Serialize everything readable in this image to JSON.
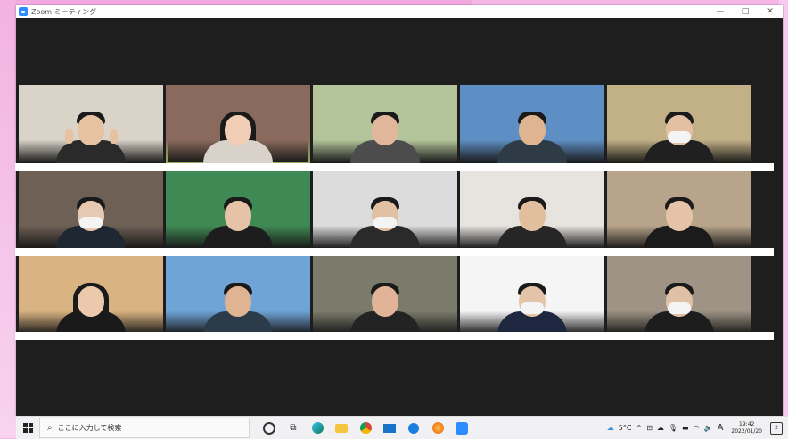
{
  "window": {
    "title": "Zoom ミーティング",
    "minimize": "—",
    "maximize": "□",
    "close": "✕"
  },
  "participants": [
    {
      "id": "p1",
      "bg": "#d9d3c8",
      "body": "#2a2a2a",
      "skin": "#e7c2a0",
      "mask": false,
      "gesture": "peace"
    },
    {
      "id": "p2",
      "bg": "#8a6a5c",
      "body": "#d9d2cb",
      "skin": "#f0cdb4",
      "mask": false,
      "active": true,
      "long_hair": true
    },
    {
      "id": "p3",
      "bg": "#b3c49a",
      "body": "#4c4c4c",
      "skin": "#e1b79b",
      "mask": false
    },
    {
      "id": "p4",
      "bg": "#5e8fc4",
      "body": "#2e3a46",
      "skin": "#dfb491",
      "mask": false
    },
    {
      "id": "p5",
      "bg": "#c2b186",
      "body": "#202020",
      "skin": "#e4c0a2",
      "mask": true
    },
    {
      "id": "p6",
      "bg": "#6e6055",
      "body": "#1f2733",
      "skin": "#e7c8b0",
      "mask": true
    },
    {
      "id": "p7",
      "bg": "#3f8a54",
      "body": "#1d1d1d",
      "skin": "#e6c3a6",
      "mask": false
    },
    {
      "id": "p8",
      "bg": "#dcdcdc",
      "body": "#2a2a2a",
      "skin": "#e2c0a4",
      "mask": true
    },
    {
      "id": "p9",
      "bg": "#e7e3df",
      "body": "#262626",
      "skin": "#e1be9e",
      "mask": false
    },
    {
      "id": "p10",
      "bg": "#b8a48a",
      "body": "#1b1b1b",
      "skin": "#e5c3a6",
      "mask": false
    },
    {
      "id": "p11",
      "bg": "#d9b381",
      "body": "#1a1a1a",
      "skin": "#eac9ad",
      "mask": false,
      "long_hair": true
    },
    {
      "id": "p12",
      "bg": "#6ea4d6",
      "body": "#2c3b49",
      "skin": "#e0b393",
      "mask": false
    },
    {
      "id": "p13",
      "bg": "#7b7b6b",
      "body": "#232323",
      "skin": "#e2b497",
      "mask": false
    },
    {
      "id": "p14",
      "bg": "#f5f5f5",
      "body": "#1d2740",
      "skin": "#e4c4a8",
      "mask": true
    },
    {
      "id": "p15",
      "bg": "#9e9384",
      "body": "#1d1d1d",
      "skin": "#e1c1a5",
      "mask": true
    }
  ],
  "taskbar": {
    "search_placeholder": "ここに入力して検索",
    "pinned_icons": [
      "cortana-icon",
      "task-view-icon",
      "edge-icon",
      "file-explorer-icon",
      "chrome-icon",
      "mail-icon",
      "app-icon",
      "firefox-icon",
      "zoom-icon"
    ],
    "weather": "5°C",
    "ime": "A",
    "time": "19:42",
    "date": "2022/01/20",
    "notification_count": "2"
  }
}
